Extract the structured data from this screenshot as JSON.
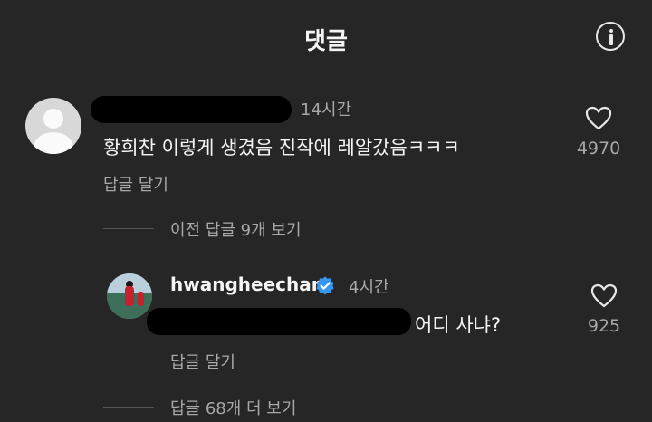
{
  "header": {
    "title": "댓글",
    "info_icon": "info-icon"
  },
  "comment": {
    "username": "",
    "time": "14시간",
    "text": "황희찬 이렇게 생겼음 진작에 레알갔음ㅋㅋㅋ",
    "reply_label": "답글 달기",
    "likes": "4970",
    "view_previous_replies": "이전 답글 9개 보기"
  },
  "reply": {
    "username": "hwangheechan",
    "verified": true,
    "time": "4시간",
    "text_visible": "어디 사냐?",
    "reply_label": "답글 달기",
    "likes": "925",
    "view_more_replies": "답글 68개 더 보기"
  },
  "colors": {
    "background": "#262626",
    "secondary_text": "#a8a8a8",
    "verified": "#3797f0"
  }
}
